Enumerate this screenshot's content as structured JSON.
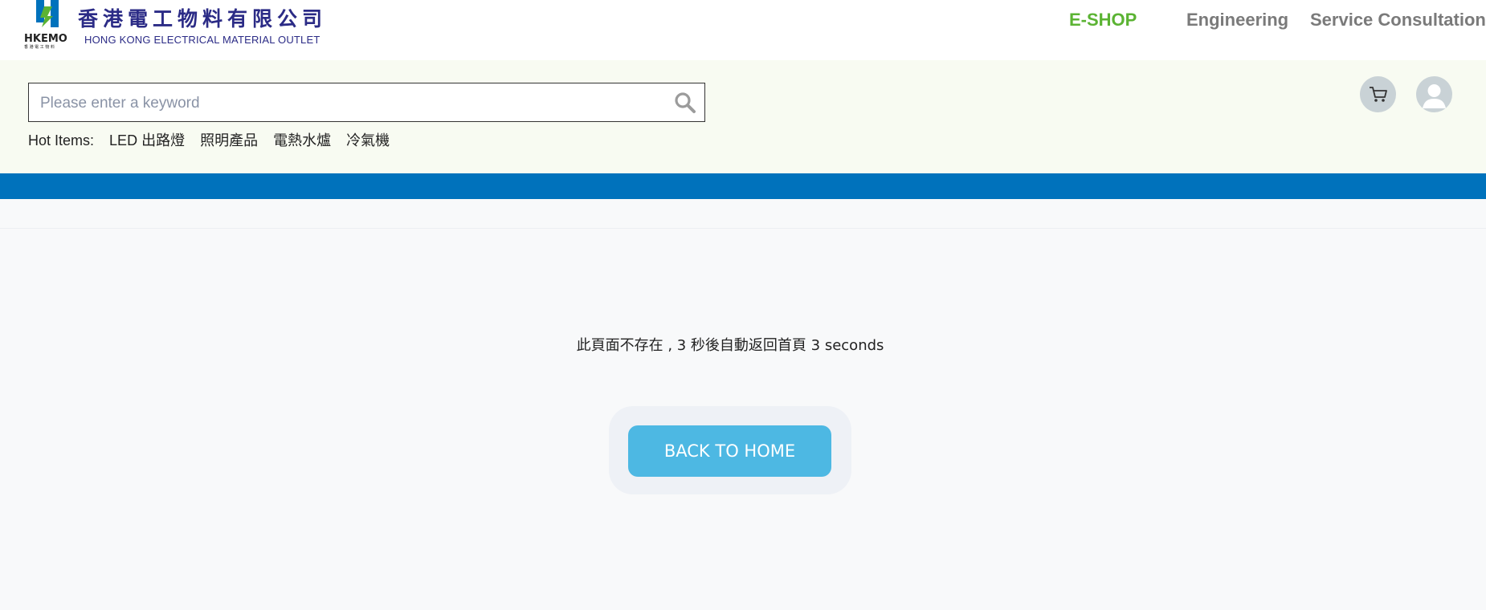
{
  "logo": {
    "zh_name": "香港電工物料有限公司",
    "brand": "HKEMO",
    "en_name": "HONG KONG ELECTRICAL MATERIAL OUTLET"
  },
  "nav": {
    "eshop": "E-SHOP",
    "engineering": "Engineering",
    "service": "Service Consultation"
  },
  "search": {
    "placeholder": "Please enter a keyword",
    "value": ""
  },
  "hot": {
    "label": "Hot Items:",
    "items": [
      "LED 出路燈",
      "照明產品",
      "電熱水爐",
      "冷氣機"
    ]
  },
  "main": {
    "message": "此頁面不存在 , 3 秒後自動返回首頁 3 seconds",
    "back_button": "BACK TO HOME"
  },
  "colors": {
    "accent_green": "#5bb333",
    "brand_blue": "#0072bc",
    "button_blue": "#4db8e3",
    "logo_navy": "#2b2b86"
  }
}
